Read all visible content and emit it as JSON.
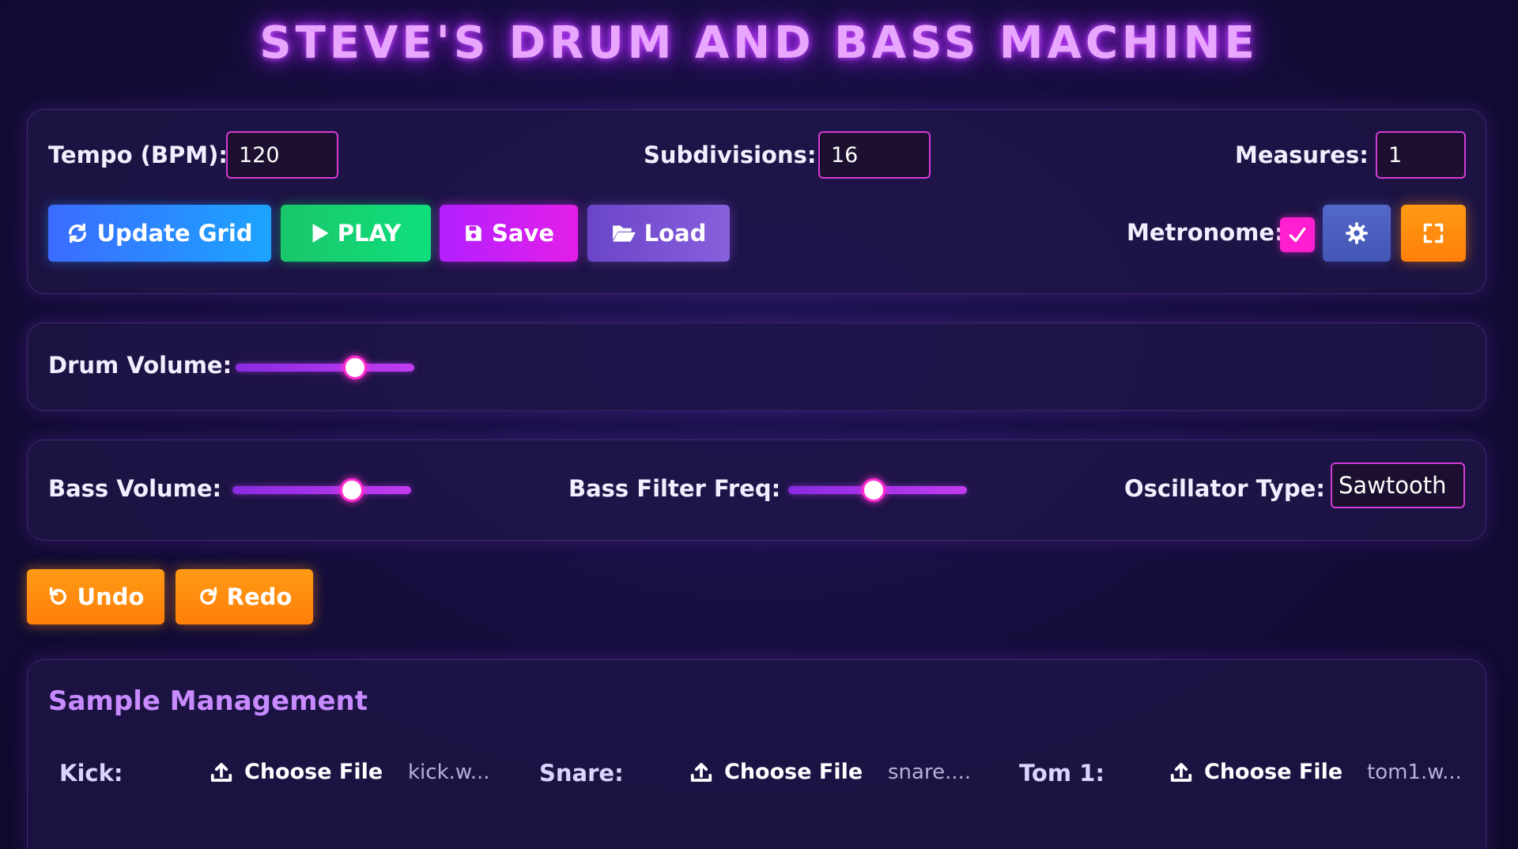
{
  "title": "STEVE'S DRUM AND BASS MACHINE",
  "controls": {
    "tempo_label": "Tempo (BPM):",
    "tempo_value": "120",
    "subdivisions_label": "Subdivisions:",
    "subdivisions_value": "16",
    "measures_label": "Measures:",
    "measures_value": "1",
    "update_grid_label": "Update Grid",
    "play_label": "PLAY",
    "save_label": "Save",
    "load_label": "Load",
    "metronome_label": "Metronome:",
    "metronome_checked": true
  },
  "drum": {
    "volume_label": "Drum Volume:",
    "volume_fraction": 0.67
  },
  "bass": {
    "volume_label": "Bass Volume:",
    "volume_fraction": 0.67,
    "filter_label": "Bass Filter Freq:",
    "filter_fraction": 0.48,
    "oscillator_label": "Oscillator Type:",
    "oscillator_value": "Sawtooth"
  },
  "history": {
    "undo_label": "Undo",
    "redo_label": "Redo"
  },
  "samples": {
    "title": "Sample Management",
    "choose_label": "Choose File",
    "items": [
      {
        "label": "Kick:",
        "file": "kick.w..."
      },
      {
        "label": "Snare:",
        "file": "snare...."
      },
      {
        "label": "Tom 1:",
        "file": "tom1.w..."
      }
    ]
  },
  "colors": {
    "accent_magenta": "#ff1fd0",
    "title_glow": "#c84dff",
    "orange": "#ff8c0f"
  }
}
